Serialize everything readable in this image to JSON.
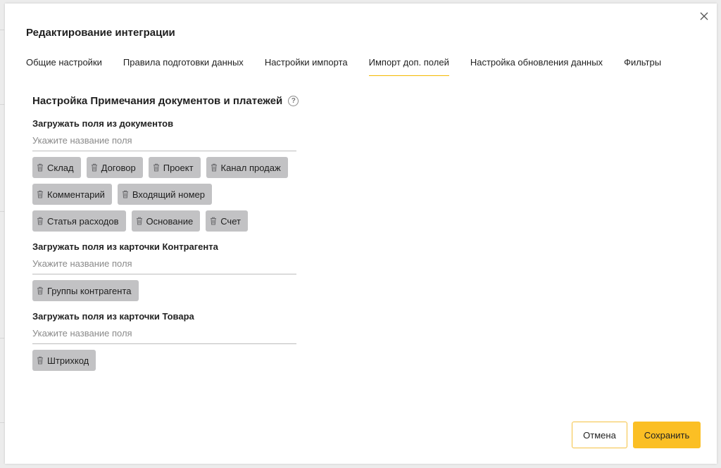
{
  "dialog": {
    "title": "Редактирование интеграции",
    "tabs": [
      {
        "label": "Общие настройки"
      },
      {
        "label": "Правила подготовки данных"
      },
      {
        "label": "Настройки импорта"
      },
      {
        "label": "Импорт доп. полей",
        "active": true
      },
      {
        "label": "Настройка обновления данных"
      },
      {
        "label": "Фильтры"
      }
    ]
  },
  "section": {
    "title": "Настройка Примечания документов и платежей",
    "help_symbol": "?",
    "groups": [
      {
        "label": "Загружать поля из документов",
        "placeholder": "Укажите название поля",
        "chips": [
          "Склад",
          "Договор",
          "Проект",
          "Канал продаж",
          "Комментарий",
          "Входящий номер",
          "Статья расходов",
          "Основание",
          "Счет"
        ]
      },
      {
        "label": "Загружать поля из карточки Контрагента",
        "placeholder": "Укажите название поля",
        "chips": [
          "Группы контрагента"
        ]
      },
      {
        "label": "Загружать поля из карточки Товара",
        "placeholder": "Укажите название поля",
        "chips": [
          "Штрихкод"
        ]
      }
    ]
  },
  "footer": {
    "cancel_label": "Отмена",
    "save_label": "Сохранить"
  },
  "colors": {
    "accent": "#fbbf24",
    "chip_bg": "#c2c2c4",
    "active_tab_underline": "#f5b800"
  },
  "icons": {
    "close": "close-icon",
    "help": "help-icon",
    "chip_remove": "trash-icon"
  }
}
